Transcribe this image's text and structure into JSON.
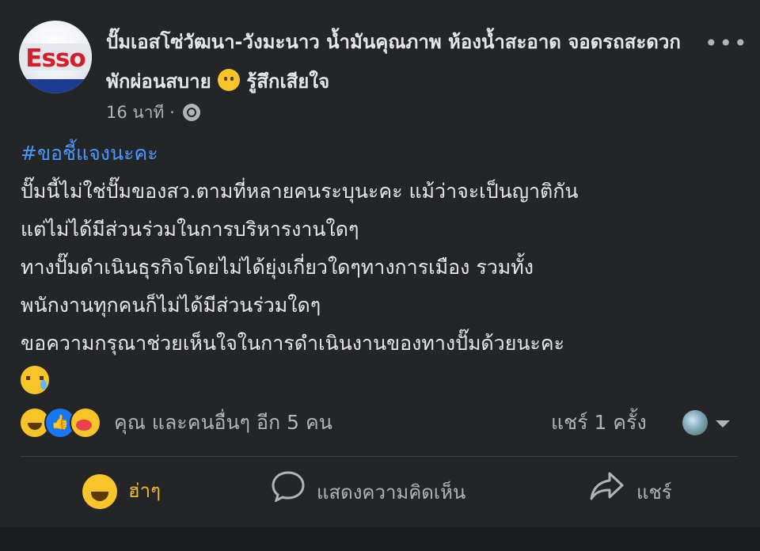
{
  "post": {
    "page_logo_text": "Esso",
    "title": "ปั๊มเอสโซ่วัฒนา-วังมะนาว น้ำมันคุณภาพ ห้องน้ำสะอาด จอดรถสะดวก พักผ่อนสบาย",
    "feeling": "รู้สึกเสียใจ",
    "more_label": "•••",
    "time": "16 นาที ·",
    "hashtag": "#ขอชี้แจงนะคะ",
    "lines": [
      "ปั๊มนี้ไม่ใช่ปั๊มของสว.ตามที่หลายคนระบุนะคะ แม้ว่าจะเป็นญาติกัน",
      "แต่ไม่ได้มีส่วนร่วมในการบริหารงานใดๆ",
      "ทางปั๊มดำเนินธุรกิจโดยไม่ได้ยุ่งเกี่ยวใดๆทางการเมือง รวมทั้ง",
      "พนักงานทุกคนก็ไม่ได้มีส่วนร่วมใดๆ",
      "ขอความกรุณาช่วยเห็นใจในการดำเนินงานของทางปั๊มด้วยนะคะ"
    ]
  },
  "reactions": {
    "summary": "คุณ และคนอื่นๆ อีก 5 คน",
    "shares": "แชร์ 1 ครั้ง",
    "icons": [
      "haha-icon",
      "like-icon",
      "care-icon"
    ]
  },
  "actions": {
    "react_label": "ฮ่าๆ",
    "comment_label": "แสดงความคิดเห็น",
    "share_label": "แชร์"
  },
  "colors": {
    "background": "#242526",
    "text": "#e4e6eb",
    "muted": "#b0b3b8",
    "hashtag": "#4599ff",
    "haha": "#f7b928"
  }
}
